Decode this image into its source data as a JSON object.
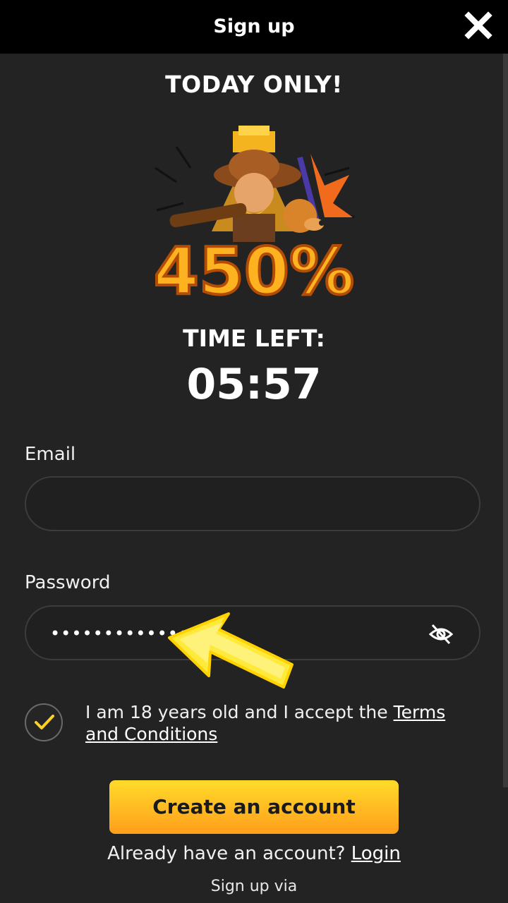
{
  "header": {
    "title": "Sign up",
    "close_icon": "close-icon"
  },
  "promo": {
    "title": "TODAY ONLY!",
    "bonus_text": "450%",
    "timer_label": "TIME LEFT:",
    "timer_value": "05:57"
  },
  "form": {
    "email_label": "Email",
    "email_value": "",
    "password_label": "Password",
    "password_value": "••••••••••••••",
    "password_toggle_icon": "eye-off-icon",
    "terms_checked": true,
    "terms_text": "I am 18 years old and I accept the ",
    "terms_link": "Terms and Conditions",
    "create_button": "Create an account",
    "login_prompt": "Already have an account? ",
    "login_link": "Login",
    "signup_via": "Sign up via"
  },
  "colors": {
    "background": "#232323",
    "header": "#000000",
    "accent": "#ffc21f"
  }
}
